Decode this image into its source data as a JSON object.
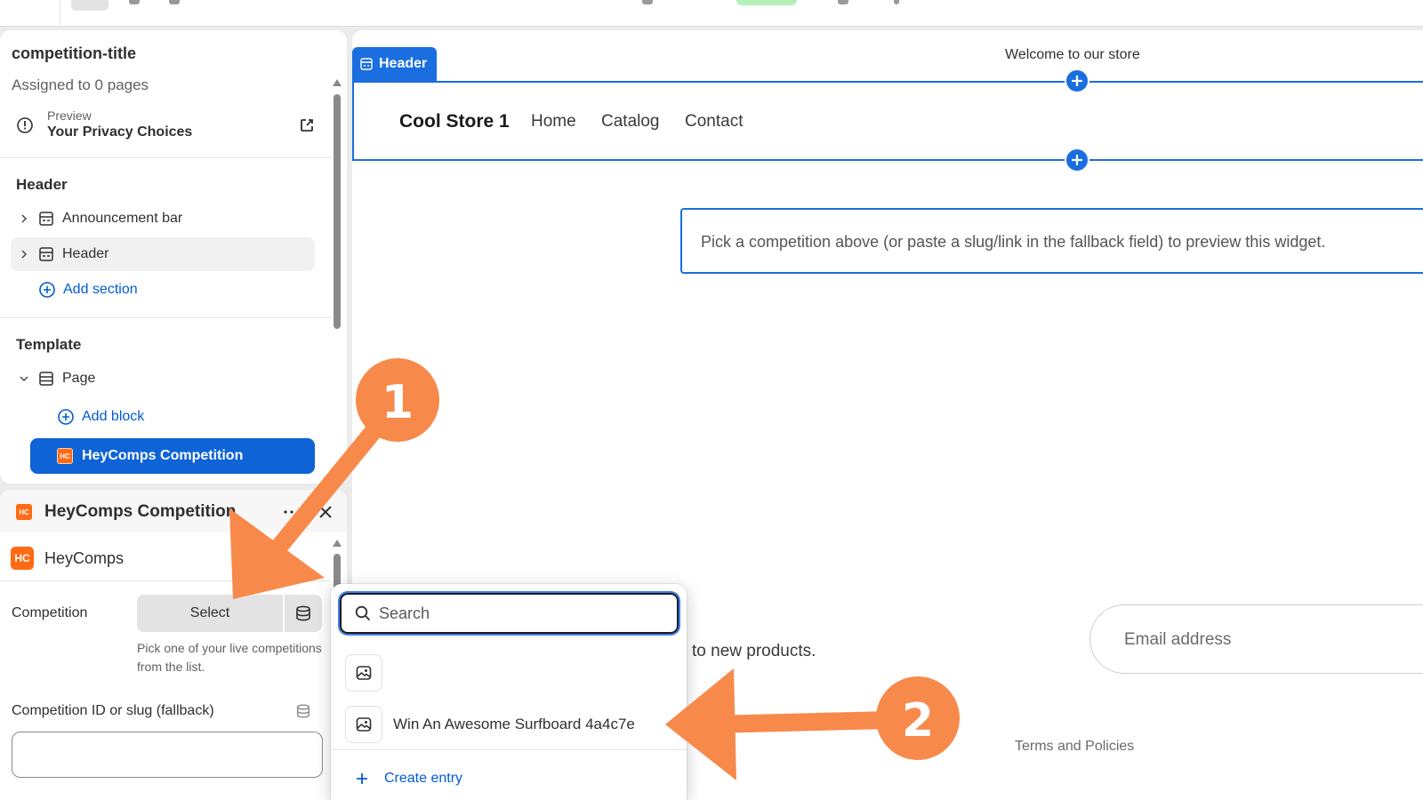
{
  "colors": {
    "accent_blue": "#1a6ee0",
    "selected_block": "#0e63d6",
    "link_blue": "#005bd3",
    "brand_orange": "#ff6a13",
    "annotation_orange": "#f7894b"
  },
  "sidebar": {
    "title": "competition-title",
    "assigned": "Assigned to 0 pages",
    "preview_label": "Preview",
    "preview_value": "Your Privacy Choices",
    "header_group": "Header",
    "header_items": [
      {
        "label": "Announcement bar",
        "icon": "section-icon"
      },
      {
        "label": "Header",
        "icon": "section-icon"
      }
    ],
    "add_section": "Add section",
    "template_group": "Template",
    "page_item": "Page",
    "add_block": "Add block",
    "selected_block": "HeyComps Competition",
    "logo_text": "HC"
  },
  "settings_panel": {
    "title": "HeyComps Competition",
    "app_name": "HeyComps",
    "competition_label": "Competition",
    "select_button": "Select",
    "help_text": "Pick one of your live competitions from the list.",
    "fallback_label": "Competition ID or slug (fallback)",
    "fallback_value": ""
  },
  "preview": {
    "welcome": "Welcome to our store",
    "header_tag": "Header",
    "brand": "Cool Store 1",
    "nav": [
      "Home",
      "Catalog",
      "Contact"
    ],
    "widget_message": "Pick a competition above (or paste a slug/link in the fallback field) to preview this widget.",
    "newsletter_fragment": "to new products.",
    "email_placeholder": "Email address",
    "terms": "Terms and Policies"
  },
  "popover": {
    "search_placeholder": "Search",
    "items": [
      {
        "label": ""
      },
      {
        "label": "Win An Awesome Surfboard 4a4c7e"
      }
    ],
    "create_entry": "Create entry"
  },
  "annotations": {
    "step1": "1",
    "step2": "2"
  }
}
